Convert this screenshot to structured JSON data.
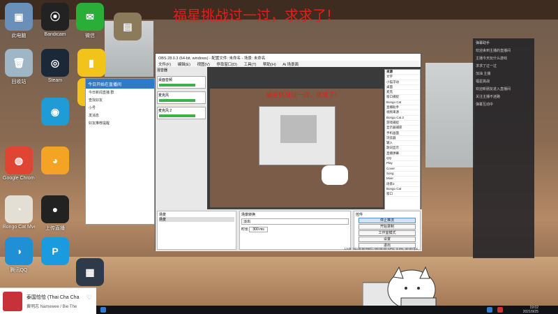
{
  "desktop": {
    "headline": "福星挑战过一过，求求了!",
    "icons": [
      {
        "label": "此电脑",
        "color": "#6a8fb8",
        "glyph": "▣"
      },
      {
        "label": "Bandicam",
        "color": "#222",
        "glyph": "⦿"
      },
      {
        "label": "微信",
        "color": "#2aae37",
        "glyph": "✉"
      },
      {
        "label": "",
        "color": "#8b7b5a",
        "glyph": "▤"
      },
      {
        "label": "回收站",
        "color": "#9fb6c7",
        "glyph": "🗑"
      },
      {
        "label": "Steam",
        "color": "#1b2838",
        "glyph": "◎"
      },
      {
        "label": "",
        "color": "#f2c31b",
        "glyph": "▮"
      },
      {
        "label": "",
        "color": "#f2c31b",
        "glyph": "▮"
      },
      {
        "label": "",
        "color": "#1f9bd6",
        "glyph": "◉"
      },
      {
        "label": "Google Chrome",
        "color": "#e04433",
        "glyph": "◍"
      },
      {
        "label": "",
        "color": "#f4a324",
        "glyph": "◕"
      },
      {
        "label": "Bongo Cat Mver",
        "color": "#e3dfd5",
        "glyph": "◔"
      },
      {
        "label": "上传直播",
        "color": "#222",
        "glyph": "●"
      },
      {
        "label": "腾讯QQ",
        "color": "#1f8fd6",
        "glyph": "◑"
      },
      {
        "label": "",
        "color": "#1a9be0",
        "glyph": "P"
      },
      {
        "label": "",
        "color": "#2e3a4a",
        "glyph": "▦"
      }
    ]
  },
  "qq": {
    "header": "今日开始在直播间",
    "rows": [
      "今日新闻直播 群",
      "查找好友",
      "小号",
      "发消息",
      "好友推荐提醒"
    ]
  },
  "obs": {
    "title": "OBS 28.0.3 (64-bit, windows) - 配置文件: 未命名 - 场景: 未命名",
    "menu": [
      "文件(F)",
      "编辑(E)",
      "视图(V)",
      "停靠窗口(D)",
      "工具(T)",
      "帮助(H)",
      "Ai 场景面"
    ],
    "mixer_title": "混音器",
    "mixer_tracks": [
      "桌面音频",
      "麦克风",
      "麦克风 2"
    ],
    "canvas_headline": "福星挑战过一过，求求了!",
    "sources_title": "来源",
    "sources": [
      "文字",
      "小猫浮动",
      "桌面",
      "麦克",
      "窗口捕捉",
      "Bongo Cat",
      "直播助手",
      "视频来源",
      "Bongo Cat 2",
      "游戏捕捉",
      "显示器捕获",
      "手机画面",
      "浏览器",
      "输入",
      "歌词显示",
      "直播弹幕",
      "QQ",
      "Play",
      "Cover",
      "Song",
      "Mver",
      "场景2",
      "Bongo Cat",
      "窗口"
    ],
    "scenes_title": "场景",
    "scenes": [
      "场景"
    ],
    "transitions_title": "场景转换",
    "transition_value": "淡出",
    "duration_label": "时长",
    "duration_value": "300 ms",
    "controls_title": "控件",
    "controls": [
      "停止推流",
      "开始录制",
      "工作室模式",
      "设置",
      "退出"
    ],
    "status": "LIVE: 00:00:00   REC: 00:00:00   CPU: 3.4%, 30.00 fps"
  },
  "side_panel": {
    "title": "弹幕助手",
    "messages": [
      "欢迎来到主播的直播间",
      "主播今天玩什么游戏",
      "求求了过一过",
      "加油 主播",
      "福星挑战",
      "欢迎新朋友进入直播间",
      "关注主播不迷路",
      "弹幕互动中"
    ]
  },
  "music": {
    "title": "泰国恰恰 (Thai Cha Cha",
    "artist": "黄明志 Namewee / Bie The"
  },
  "taskbar": {
    "time": "19:02",
    "date": "2021/9/25"
  }
}
